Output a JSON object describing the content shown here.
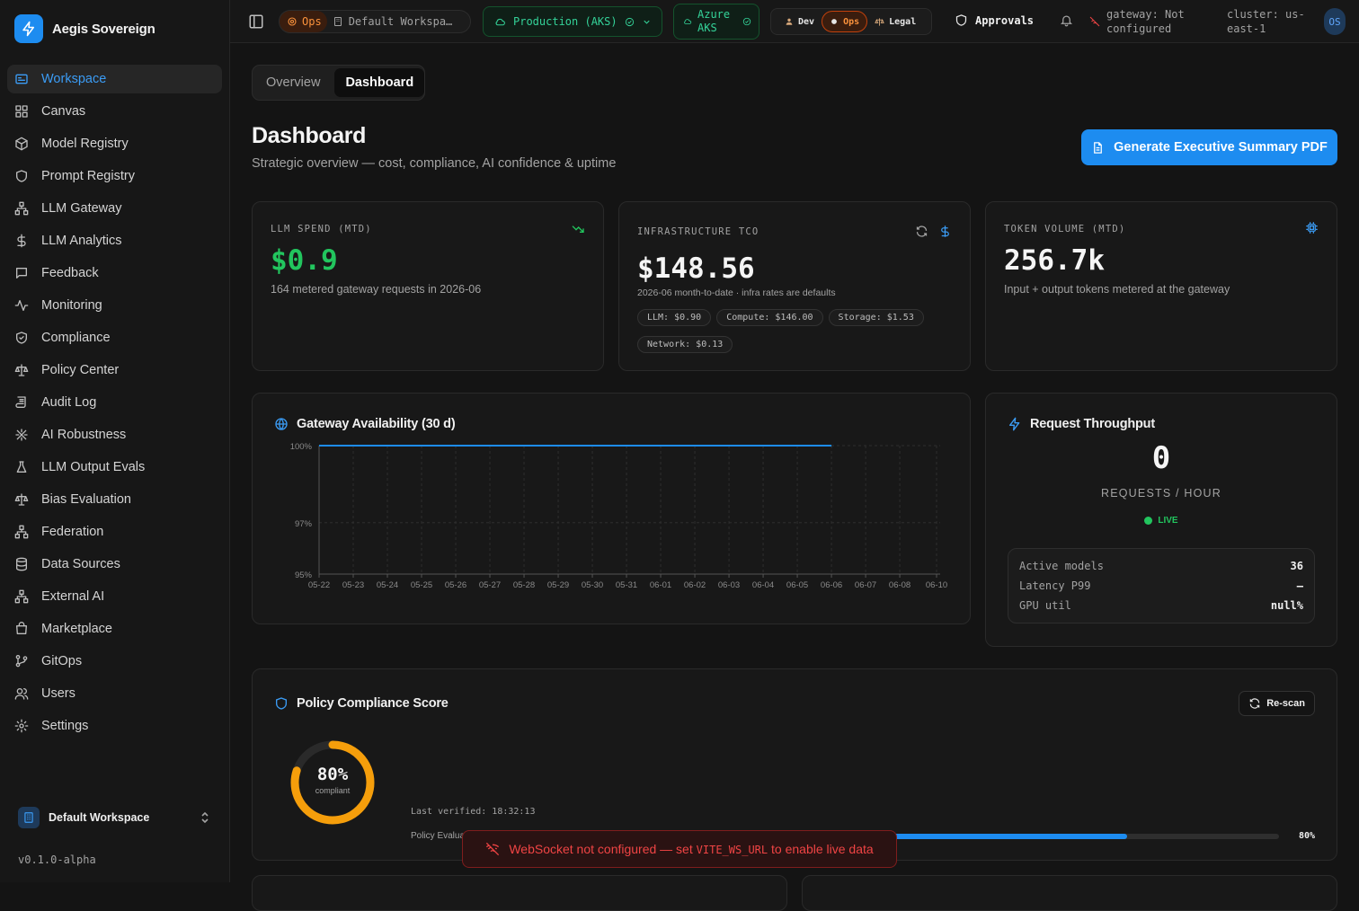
{
  "brand": {
    "name": "Aegis Sovereign"
  },
  "sidebar": {
    "items": [
      {
        "label": "Workspace",
        "icon": "workspace-icon"
      },
      {
        "label": "Canvas",
        "icon": "grid-icon"
      },
      {
        "label": "Model Registry",
        "icon": "cube-icon"
      },
      {
        "label": "Prompt Registry",
        "icon": "shield-icon"
      },
      {
        "label": "LLM Gateway",
        "icon": "network-icon"
      },
      {
        "label": "LLM Analytics",
        "icon": "dollar-icon"
      },
      {
        "label": "Feedback",
        "icon": "chat-icon"
      },
      {
        "label": "Monitoring",
        "icon": "pulse-icon"
      },
      {
        "label": "Compliance",
        "icon": "shield-check-icon"
      },
      {
        "label": "Policy Center",
        "icon": "scale-icon"
      },
      {
        "label": "Audit Log",
        "icon": "scroll-icon"
      },
      {
        "label": "AI Robustness",
        "icon": "bug-icon"
      },
      {
        "label": "LLM Output Evals",
        "icon": "flask-icon"
      },
      {
        "label": "Bias Evaluation",
        "icon": "scale-icon"
      },
      {
        "label": "Federation",
        "icon": "network-icon"
      },
      {
        "label": "Data Sources",
        "icon": "database-icon"
      },
      {
        "label": "External AI",
        "icon": "network-icon"
      },
      {
        "label": "Marketplace",
        "icon": "store-icon"
      },
      {
        "label": "GitOps",
        "icon": "git-branch-icon"
      },
      {
        "label": "Users",
        "icon": "users-icon"
      },
      {
        "label": "Settings",
        "icon": "gear-icon"
      }
    ],
    "workspace_switcher": "Default Workspace",
    "version": "v0.1.0-alpha"
  },
  "topbar": {
    "ops_badge": "Ops",
    "workspace": "Default Workspa…",
    "environment": "Production (AKS)",
    "cloud_line1": "Azure",
    "cloud_line2": "AKS",
    "personas": [
      "Dev",
      "Ops",
      "Legal"
    ],
    "approvals": "Approvals",
    "gateway_line1": "gateway: Not",
    "gateway_line2": "configured",
    "cluster_line1": "cluster: us-",
    "cluster_line2": "east-1",
    "avatar": "OS"
  },
  "tabs": [
    "Overview",
    "Dashboard"
  ],
  "page": {
    "title": "Dashboard",
    "subtitle": "Strategic overview — cost, compliance, AI confidence & uptime",
    "generate_button": "Generate Executive Summary PDF"
  },
  "kpis": {
    "llm_spend": {
      "label": "LLM SPEND (MTD)",
      "value": "$0.9",
      "desc": "164 metered gateway requests in 2026-06"
    },
    "infra_tco": {
      "label": "INFRASTRUCTURE TCO",
      "value": "$148.56",
      "desc": "2026-06 month-to-date · infra rates are defaults",
      "chips": [
        "LLM: $0.90",
        "Compute: $146.00",
        "Storage: $1.53",
        "Network: $0.13"
      ]
    },
    "token_volume": {
      "label": "TOKEN VOLUME (MTD)",
      "value": "256.7k",
      "desc": "Input + output tokens metered at the gateway"
    }
  },
  "availability": {
    "title": "Gateway Availability (30 d)",
    "chart_data": {
      "type": "line",
      "title": "Gateway Availability (30 d)",
      "x": [
        "05-22",
        "05-23",
        "05-24",
        "05-25",
        "05-26",
        "05-27",
        "05-28",
        "05-29",
        "05-30",
        "05-31",
        "06-01",
        "06-02",
        "06-03",
        "06-04",
        "06-05",
        "06-06",
        "06-07",
        "06-08",
        "06-10"
      ],
      "x_tick_labels": [
        "05-22",
        "05-23",
        "05-24",
        "05-25",
        "05-26",
        "05-27",
        "05-28",
        "05-29",
        "05-30",
        "05-31",
        "06-01",
        "06-02",
        "06-03",
        "06-04",
        "06-05",
        "06-06",
        "06-07",
        "06-08",
        "06-10"
      ],
      "y_tick_labels": [
        "100%",
        "97%",
        "95%"
      ],
      "series": [
        {
          "values": [
            100,
            100,
            100,
            100,
            100,
            100,
            100,
            100,
            100,
            100,
            100,
            100,
            100,
            100,
            100,
            100
          ],
          "color": "#1d8cf0"
        }
      ],
      "ylim": [
        95,
        100
      ],
      "grid": true
    }
  },
  "throughput": {
    "title": "Request Throughput",
    "value": "0",
    "unit": "REQUESTS / HOUR",
    "live": "LIVE",
    "metrics": [
      {
        "label": "Active models",
        "value": "36"
      },
      {
        "label": "Latency P99",
        "value": "—"
      },
      {
        "label": "GPU util",
        "value": "null%"
      }
    ]
  },
  "compliance": {
    "title": "Policy Compliance Score",
    "rescan": "Re-scan",
    "score": "80%",
    "score_value": 80,
    "score_caption": "compliant",
    "last_verified": "Last verified: 18:32:13",
    "bar_label": "Policy Evaluations",
    "bar_value_label": "80%",
    "bar_value": 80
  },
  "toast": {
    "text_before": "WebSocket not configured — set ",
    "code": "VITE_WS_URL",
    "text_after": " to enable live data"
  },
  "colors": {
    "accent": "#1d8cf0",
    "success": "#22c55e",
    "warning": "#f59e0b",
    "error": "#ef4444",
    "ops": "#f97316"
  }
}
